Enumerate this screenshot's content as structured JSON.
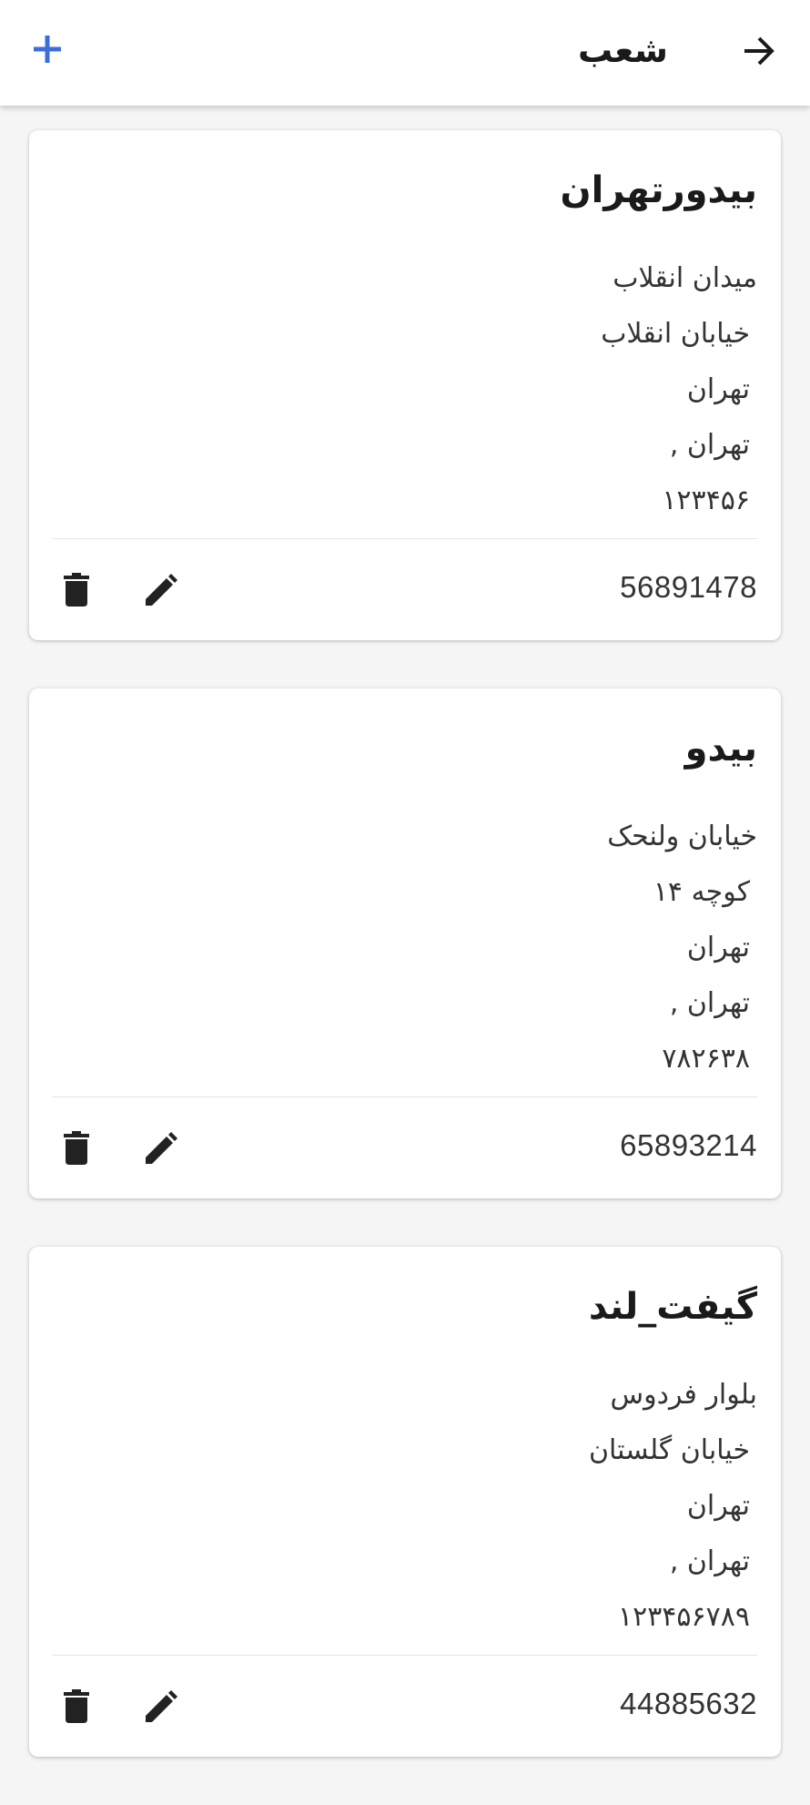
{
  "header": {
    "title": "شعب",
    "add_icon": "plus-icon",
    "back_icon": "arrow-right-icon",
    "accent_color": "#3b6fd8"
  },
  "branches": [
    {
      "name": "بیدورتهران",
      "line1": "میدان انقلاب",
      "line2": "خیابان انقلاب",
      "line3": "تهران",
      "line4": "تهران ,",
      "postal": "۱۲۳۴۵۶",
      "phone": "56891478"
    },
    {
      "name": "بیدو",
      "line1": "خیابان ولنحک",
      "line2": "کوچه ۱۴",
      "line3": "تهران",
      "line4": "تهران ,",
      "postal": "۷۸۲۶۳۸",
      "phone": "65893214"
    },
    {
      "name": "گیفت_لند",
      "line1": "بلوار فردوس",
      "line2": "خیابان گلستان",
      "line3": "تهران",
      "line4": "تهران ,",
      "postal": "۱۲۳۴۵۶۷۸۹",
      "phone": "44885632"
    }
  ]
}
